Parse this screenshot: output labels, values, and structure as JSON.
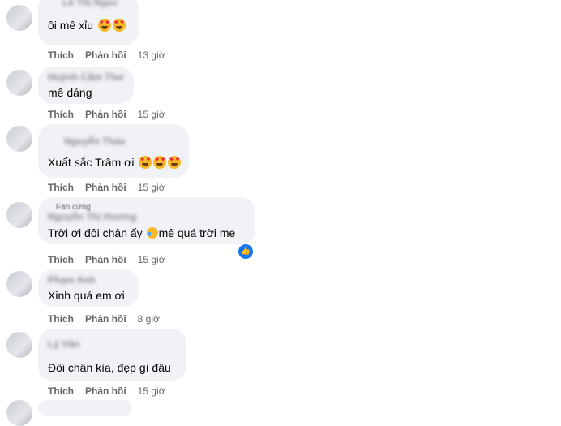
{
  "comments": [
    {
      "author": "Lê Thị Ngọc",
      "badge": "",
      "text": "ôi mê xỉu",
      "emoji_count": 2,
      "actions": {
        "like": "Thích",
        "reply": "Phản hồi",
        "time": "13 giờ"
      }
    },
    {
      "author": "Huỳnh Cẩm Thư",
      "badge": "",
      "text": "mê dáng",
      "actions": {
        "like": "Thích",
        "reply": "Phản hồi",
        "time": "15 giờ"
      }
    },
    {
      "author": "Nguyễn Thảo",
      "badge": "",
      "text": "Xuất sắc Trâm ơi",
      "emoji_count": 3,
      "actions": {
        "like": "Thích",
        "reply": "Phản hồi",
        "time": "15 giờ"
      }
    },
    {
      "author": "Nguyễn Thị Hương",
      "badge": "Fan cứng",
      "text_before": "Trời ơi đôi chân ấy ",
      "text_after": "mê quá trời me",
      "reaction_icon": "like-icon",
      "actions": {
        "like": "Thích",
        "reply": "Phản hồi",
        "time": "15 giờ"
      }
    },
    {
      "author": "Phạm Anh",
      "badge": "",
      "text": "Xinh quá em ơi",
      "actions": {
        "like": "Thích",
        "reply": "Phản hồi",
        "time": "8 giờ"
      }
    },
    {
      "author": "Lý Vân",
      "badge": "",
      "text": "Đôi chân kìa, đẹp gì đâu",
      "actions": {
        "like": "Thích",
        "reply": "Phản hồi",
        "time": "15 giờ"
      }
    }
  ],
  "colors": {
    "bubble": "#f0f2f5",
    "meta_text": "#65676b",
    "like_blue": "#1877f2"
  }
}
